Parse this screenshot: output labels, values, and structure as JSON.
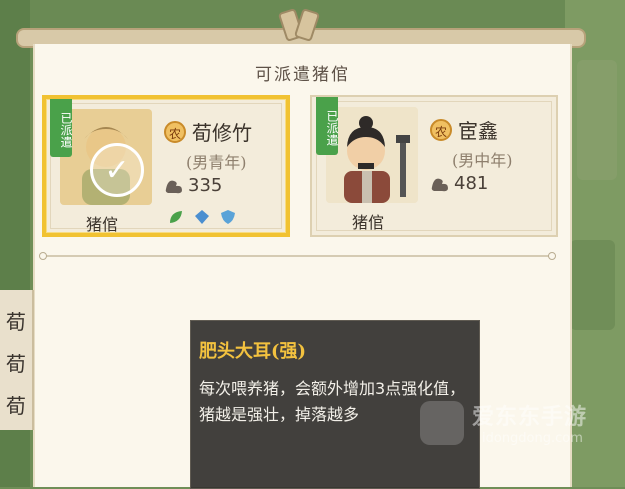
{
  "panel": {
    "title": "可派遣猪倌"
  },
  "cards": [
    {
      "tag": "已派遣",
      "badge": "农",
      "name": "荀修竹",
      "subtitle": "(男青年)",
      "power": "335",
      "role": "猪倌",
      "selected": true,
      "skills": [
        "green-leaf-icon",
        "blue-gem-icon",
        "blue-shield-icon"
      ]
    },
    {
      "tag": "已派遣",
      "badge": "农",
      "name": "宦鑫",
      "subtitle": "(男中年)",
      "power": "481",
      "role": "猪倌",
      "selected": false
    }
  ],
  "left_list": [
    "荀",
    "荀",
    "荀"
  ],
  "tooltip": {
    "title": "肥头大耳(强)",
    "body": "每次喂养猪，会额外增加3点强化值，猪越是强壮，掉落越多"
  },
  "watermark": {
    "text": "爱东东手游",
    "url": "idongdong.com"
  },
  "colors": {
    "selected_border": "#f1c232",
    "tag_green": "#4aa14a",
    "tip_title": "#f3c23f"
  }
}
